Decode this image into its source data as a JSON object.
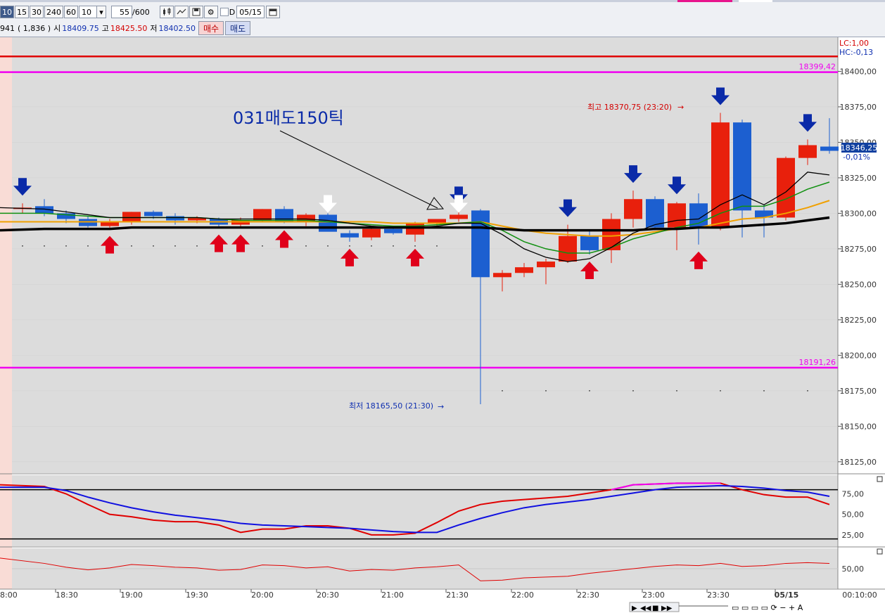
{
  "toolbar": {
    "intervals": [
      "10",
      "15",
      "30",
      "240",
      "60"
    ],
    "period_value": "10",
    "count_value": "55",
    "count_total": "/600",
    "date_value": "05/15",
    "d_label": "D",
    "quote_prefix": "941",
    "quote_change": "( 1,836  )",
    "open_label": "시",
    "open_value": "18409.75",
    "high_label": "고",
    "high_value": "18425.50",
    "low_label": "저",
    "low_value": "18402.50",
    "buy_label": "매수",
    "sell_label": "매도"
  },
  "colors": {
    "up": "#e8200c",
    "down": "#1c5fd0",
    "magenta": "#f000f0",
    "red_line": "#e00000",
    "ma_black": "#000000",
    "ma_green": "#109010",
    "ma_orange": "#f0a000",
    "marker_red": "#e0001a",
    "marker_blue": "#0a2aa8"
  },
  "chart_data": {
    "type": "candlestick",
    "x_tick_labels": [
      "8:00",
      "18:30",
      "19:00",
      "19:30",
      "20:00",
      "20:30",
      "21:00",
      "21:30",
      "22:00",
      "22:30",
      "23:00",
      "23:30",
      "05/15",
      "00:10:00"
    ],
    "y_ticks": [
      18400,
      18375,
      18350,
      18325,
      18300,
      18275,
      18250,
      18225,
      18200,
      18175,
      18150,
      18125
    ],
    "y_tick_labels": [
      "18400,00",
      "18375,00",
      "18350,00",
      "18325,00",
      "18300,00",
      "18275,00",
      "18250,00",
      "18225,00",
      "18200,00",
      "18175,00",
      "18150,00",
      "18125,00"
    ],
    "ylim": [
      18117,
      18424
    ],
    "candles": [
      {
        "o": 18304,
        "h": 18307,
        "l": 18300,
        "c": 18304
      },
      {
        "o": 18305,
        "h": 18310,
        "l": 18298,
        "c": 18300
      },
      {
        "o": 18300,
        "h": 18302,
        "l": 18293,
        "c": 18296
      },
      {
        "o": 18296,
        "h": 18298,
        "l": 18290,
        "c": 18291
      },
      {
        "o": 18291,
        "h": 18296,
        "l": 18289,
        "c": 18294
      },
      {
        "o": 18294,
        "h": 18301,
        "l": 18292,
        "c": 18301
      },
      {
        "o": 18301,
        "h": 18302,
        "l": 18296,
        "c": 18298
      },
      {
        "o": 18298,
        "h": 18300,
        "l": 18292,
        "c": 18295
      },
      {
        "o": 18295,
        "h": 18298,
        "l": 18293,
        "c": 18297
      },
      {
        "o": 18296,
        "h": 18297,
        "l": 18290,
        "c": 18292
      },
      {
        "o": 18292,
        "h": 18297,
        "l": 18290,
        "c": 18295
      },
      {
        "o": 18295,
        "h": 18303,
        "l": 18294,
        "c": 18303
      },
      {
        "o": 18303,
        "h": 18305,
        "l": 18293,
        "c": 18294
      },
      {
        "o": 18294,
        "h": 18300,
        "l": 18291,
        "c": 18299
      },
      {
        "o": 18299,
        "h": 18300,
        "l": 18288,
        "c": 18287
      },
      {
        "o": 18286,
        "h": 18288,
        "l": 18280,
        "c": 18283
      },
      {
        "o": 18283,
        "h": 18290,
        "l": 18281,
        "c": 18289
      },
      {
        "o": 18289,
        "h": 18291,
        "l": 18285,
        "c": 18286
      },
      {
        "o": 18285,
        "h": 18294,
        "l": 18280,
        "c": 18293
      },
      {
        "o": 18293,
        "h": 18296,
        "l": 18290,
        "c": 18296
      },
      {
        "o": 18296,
        "h": 18301,
        "l": 18294,
        "c": 18299
      },
      {
        "o": 18302,
        "h": 18303,
        "l": 18165.5,
        "c": 18255
      },
      {
        "o": 18255,
        "h": 18260,
        "l": 18245,
        "c": 18258
      },
      {
        "o": 18258,
        "h": 18265,
        "l": 18255,
        "c": 18262
      },
      {
        "o": 18262,
        "h": 18268,
        "l": 18250,
        "c": 18266
      },
      {
        "o": 18266,
        "h": 18292,
        "l": 18265,
        "c": 18284
      },
      {
        "o": 18284,
        "h": 18288,
        "l": 18271,
        "c": 18274
      },
      {
        "o": 18274,
        "h": 18300,
        "l": 18265,
        "c": 18296
      },
      {
        "o": 18296,
        "h": 18316,
        "l": 18290,
        "c": 18310
      },
      {
        "o": 18310,
        "h": 18312,
        "l": 18288,
        "c": 18290
      },
      {
        "o": 18290,
        "h": 18308,
        "l": 18274,
        "c": 18307
      },
      {
        "o": 18307,
        "h": 18314,
        "l": 18278,
        "c": 18290
      },
      {
        "o": 18290,
        "h": 18370.75,
        "l": 18288,
        "c": 18364
      },
      {
        "o": 18364,
        "h": 18366,
        "l": 18283,
        "c": 18302
      },
      {
        "o": 18302,
        "h": 18306,
        "l": 18283,
        "c": 18297
      },
      {
        "o": 18297,
        "h": 18340,
        "l": 18295,
        "c": 18339
      },
      {
        "o": 18339,
        "h": 18352,
        "l": 18334,
        "c": 18348
      },
      {
        "o": 18347,
        "h": 18367,
        "l": 18342,
        "c": 18344
      }
    ],
    "ma_black": [
      18304,
      18303,
      18301,
      18299,
      18297,
      18297,
      18297,
      18297,
      18297,
      18296,
      18296,
      18296,
      18296,
      18296,
      18295,
      18293,
      18291,
      18290,
      18290,
      18291,
      18293,
      18293,
      18285,
      18275,
      18269,
      18266,
      18268,
      18276,
      18286,
      18292,
      18295,
      18296,
      18306,
      18313,
      18306,
      18315,
      18329,
      18327
    ],
    "ma_green": [
      18300,
      18300,
      18299,
      18298,
      18297,
      18297,
      18297,
      18297,
      18297,
      18296,
      18295,
      18295,
      18295,
      18295,
      18294,
      18293,
      18292,
      18291,
      18291,
      18292,
      18293,
      18294,
      18288,
      18280,
      18275,
      18272,
      18272,
      18276,
      18282,
      18286,
      18290,
      18293,
      18300,
      18305,
      18305,
      18310,
      18317,
      18322
    ],
    "ma_orange": [
      18294,
      18294,
      18294,
      18294,
      18294,
      18294,
      18294,
      18294,
      18294,
      18294,
      18294,
      18294,
      18294,
      18294,
      18294,
      18294,
      18294,
      18293,
      18293,
      18293,
      18293,
      18294,
      18291,
      18288,
      18286,
      18285,
      18284,
      18284,
      18285,
      18287,
      18289,
      18290,
      18293,
      18296,
      18297,
      18300,
      18304,
      18309
    ],
    "ma_thick": [
      18288,
      18289,
      18289,
      18289,
      18289,
      18290,
      18290,
      18290,
      18290,
      18290,
      18290,
      18290,
      18290,
      18290,
      18290,
      18290,
      18290,
      18290,
      18290,
      18290,
      18290,
      18290,
      18289,
      18288,
      18288,
      18288,
      18288,
      18288,
      18288,
      18289,
      18289,
      18290,
      18290,
      18291,
      18292,
      18293,
      18295,
      18297
    ],
    "h_lines": [
      {
        "value": 18399.42,
        "label": "18399,42",
        "color": "magenta"
      },
      {
        "value": 18191.26,
        "label": "18191,26",
        "color": "magenta"
      },
      {
        "value": 18410.5,
        "label": "",
        "color": "red"
      }
    ],
    "lc_label": "LC:1,00",
    "hc_label": "HC:-0,13",
    "current_price": "18346,25",
    "current_change": "-0,01%",
    "current_value": 18346.25,
    "high_annotation": "최고 18370,75 (23:20)",
    "low_annotation": "최저 18165,50 (21:30)",
    "annotation_text": "031매도150틱",
    "up_arrows": [
      4,
      9,
      10,
      12,
      15,
      18,
      26,
      31
    ],
    "down_arrows": [
      0,
      20,
      25,
      28,
      30,
      32,
      36
    ],
    "white_arrows": [
      14,
      20
    ],
    "stoch": {
      "ticks": [
        75,
        50,
        25
      ],
      "tick_labels": [
        "75,00",
        "50,00",
        "25,00"
      ],
      "upper": 80,
      "lower": 20,
      "ylim": [
        12,
        96
      ],
      "k": [
        86,
        84,
        75,
        62,
        50,
        47,
        43,
        41,
        41,
        37,
        28,
        32,
        32,
        36,
        36,
        33,
        25,
        25,
        27,
        40,
        54,
        62,
        66,
        68,
        70,
        72,
        76,
        80,
        86,
        87,
        88,
        88,
        88,
        80,
        74,
        71,
        71,
        62
      ],
      "d": [
        83,
        83,
        79,
        71,
        64,
        58,
        53,
        49,
        46,
        43,
        39,
        37,
        36,
        35,
        34,
        33,
        31,
        29,
        28,
        28,
        37,
        45,
        52,
        58,
        62,
        65,
        68,
        72,
        76,
        80,
        83,
        84,
        85,
        84,
        82,
        79,
        77,
        72
      ]
    },
    "lower_panel": {
      "tick_label": "50,00",
      "tick_value": 50,
      "ylim": [
        0,
        100
      ],
      "values": [
        78,
        64,
        54,
        47,
        52,
        61,
        58,
        54,
        52,
        46,
        48,
        60,
        58,
        52,
        55,
        44,
        48,
        46,
        52,
        55,
        60,
        18,
        20,
        26,
        28,
        30,
        38,
        44,
        50,
        56,
        60,
        58,
        64,
        56,
        58,
        64,
        66,
        64
      ]
    }
  }
}
